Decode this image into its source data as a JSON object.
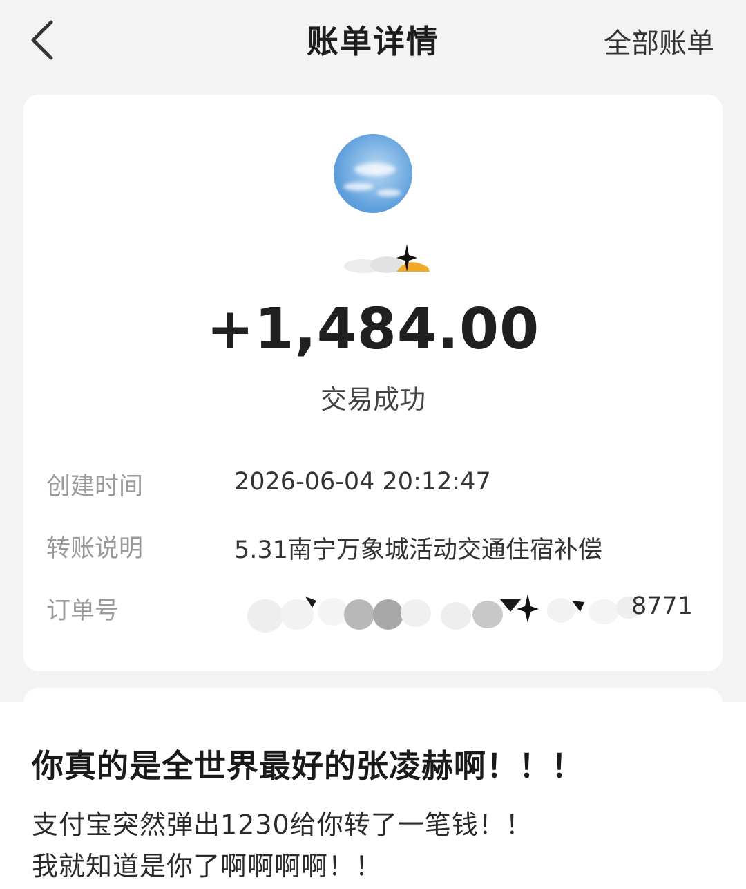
{
  "header": {
    "title": "账单详情",
    "right_link": "全部账单"
  },
  "transaction": {
    "amount": "+1,484.00",
    "status": "交易成功",
    "details": [
      {
        "label": "创建时间",
        "value": "2026-06-04 20:12:47"
      },
      {
        "label": "转账说明",
        "value": "5.31南宁万象城活动交通住宿补偿"
      },
      {
        "label": "订单号",
        "value": "8771"
      }
    ]
  },
  "caption": {
    "title": "你真的是全世界最好的张凌赫啊！！！",
    "lines": [
      "支付宝突然弹出1230给你转了一笔钱！！",
      "我就知道是你了啊啊啊啊！！"
    ]
  },
  "colors": {
    "page_bg": "#f3f3f3",
    "card_bg": "#ffffff",
    "label_gray": "#9a9a9a",
    "avatar_blue": "#5f9fdc",
    "sticker_orange": "#f0a928"
  },
  "icons": {
    "back": "chevron-left-icon"
  }
}
